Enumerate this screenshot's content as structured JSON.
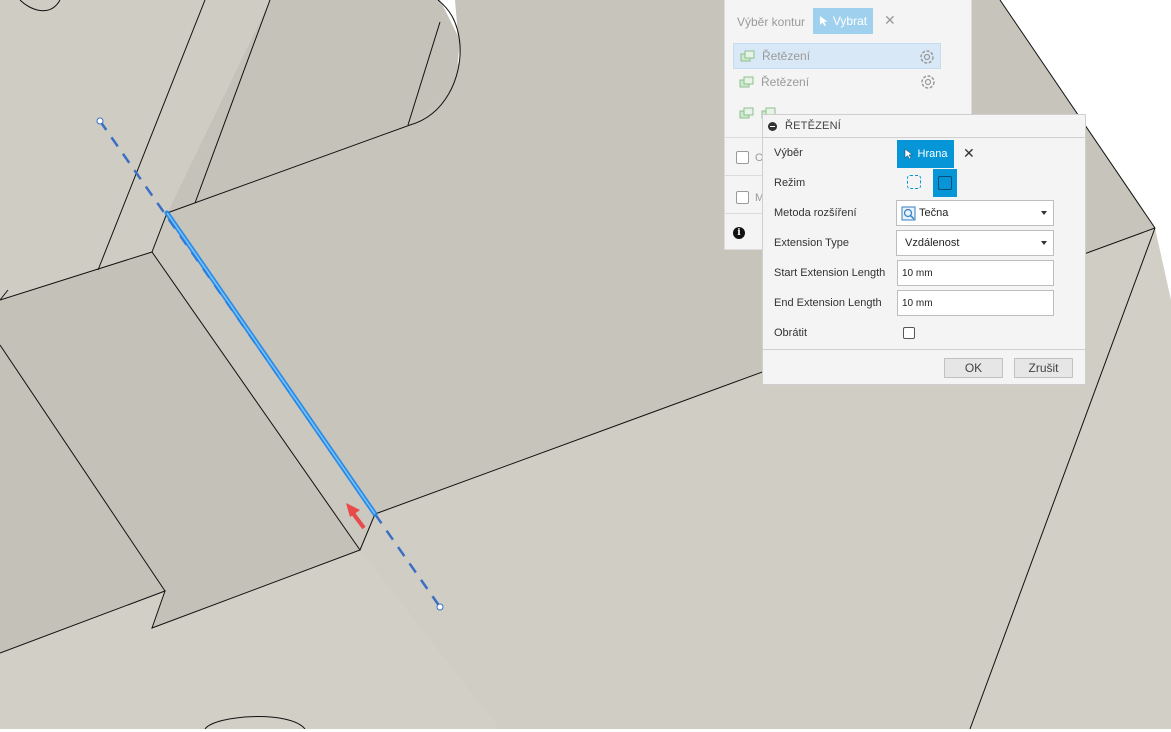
{
  "background_panel": {
    "header_label": "Výběr kontur",
    "select_label": "Vybrat",
    "chains": [
      {
        "label": "Řetězení"
      },
      {
        "label": "Řetězení"
      }
    ],
    "checkbox_1_label": "O",
    "checkbox_2_label": "M"
  },
  "dialog": {
    "title": "ŘETĚZENÍ",
    "rows": {
      "selection_label": "Výběr",
      "selection_button": "Hrana",
      "mode_label": "Režim",
      "extension_method_label": "Metoda rozšíření",
      "extension_method_value": "Tečna",
      "extension_type_label": "Extension Type",
      "extension_type_value": "Vzdálenost",
      "start_length_label": "Start Extension Length",
      "start_length_value": "10 mm",
      "end_length_label": "End Extension Length",
      "end_length_value": "10 mm",
      "reverse_label": "Obrátit"
    },
    "ok_label": "OK",
    "cancel_label": "Zrušit"
  },
  "colors": {
    "accent": "#0696d7",
    "model_face_top": "#c9c6bc",
    "model_face_front": "#c2bfb6",
    "direction_arrow": "#e84a4a",
    "extension_line": "#3a6fc4"
  }
}
